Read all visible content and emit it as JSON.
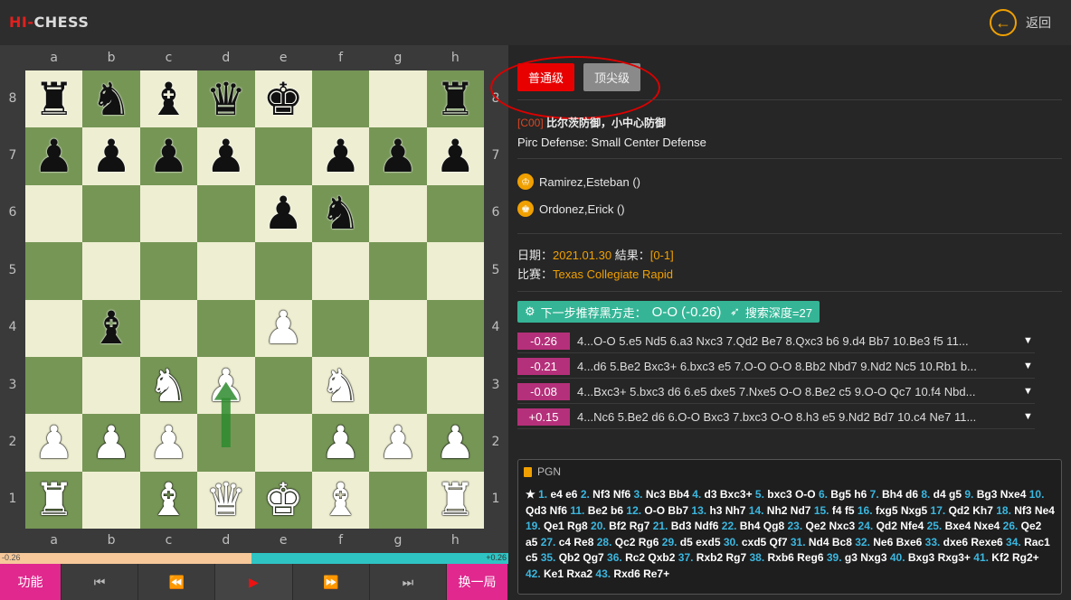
{
  "app": {
    "logo_red": "HI-",
    "logo_rest": "CHESS",
    "back_icon": "arrow-left-icon",
    "back_label": "返回"
  },
  "board": {
    "files": [
      "a",
      "b",
      "c",
      "d",
      "e",
      "f",
      "g",
      "h"
    ],
    "ranks": [
      "8",
      "7",
      "6",
      "5",
      "4",
      "3",
      "2",
      "1"
    ],
    "rows": [
      [
        "br",
        "bn",
        "bb",
        "bq",
        "bk",
        "",
        "",
        "br"
      ],
      [
        "bp",
        "bp",
        "bp",
        "bp",
        "",
        "bp",
        "bp",
        "bp"
      ],
      [
        "",
        "",
        "",
        "",
        "bp",
        "bn",
        "",
        ""
      ],
      [
        "",
        "",
        "",
        "",
        "",
        "",
        "",
        ""
      ],
      [
        "",
        "bb",
        "",
        "",
        "wp",
        "",
        "",
        ""
      ],
      [
        "",
        "",
        "wn",
        "wp",
        "",
        "wn",
        "",
        ""
      ],
      [
        "wp",
        "wp",
        "wp",
        "",
        "",
        "wp",
        "wp",
        "wp"
      ],
      [
        "wr",
        "",
        "wb",
        "wq",
        "wk",
        "wb",
        "",
        "wr"
      ]
    ],
    "arrow_from": "d2",
    "arrow_to": "d3",
    "arrow_color": "#2e8b2e"
  },
  "evalbar": {
    "left_label": "-0.26",
    "right_label": "+0.26",
    "fill_fraction": 0.495
  },
  "controls": {
    "func_label": "功能",
    "first_icon": "skip-first-icon",
    "prev_icon": "rewind-icon",
    "play_icon": "play-icon",
    "next_icon": "fast-forward-icon",
    "last_icon": "skip-last-icon",
    "newgame_label": "换一局"
  },
  "levels": {
    "normal": "普通级",
    "top": "顶尖级"
  },
  "opening": {
    "eco": "[C00]",
    "name_cn": "比尔茨防御，小中心防御",
    "name_en": "Pirc Defense: Small Center Defense"
  },
  "players": {
    "white": "Ramirez,Esteban ()",
    "black": "Ordonez,Erick ()"
  },
  "meta": {
    "date_label": "日期：",
    "date_value": "2021.01.30",
    "result_label": " 結果：",
    "result_value": "[0-1]",
    "event_label": "比赛：",
    "event_value": "Texas Collegiate Rapid"
  },
  "recommend": {
    "text": "下一步推荐黑方走：",
    "move": "O-O (-0.26)",
    "depth": "搜索深度=27"
  },
  "lines": [
    {
      "score": "-0.26",
      "text": "4...O-O 5.e5 Nd5 6.a3 Nxc3 7.Qd2 Be7 8.Qxc3 b6 9.d4 Bb7 10.Be3 f5 11..."
    },
    {
      "score": "-0.21",
      "text": "4...d6 5.Be2 Bxc3+ 6.bxc3 e5 7.O-O O-O 8.Bb2 Nbd7 9.Nd2 Nc5 10.Rb1 b..."
    },
    {
      "score": "-0.08",
      "text": "4...Bxc3+ 5.bxc3 d6 6.e5 dxe5 7.Nxe5 O-O 8.Be2 c5 9.O-O Qc7 10.f4 Nbd..."
    },
    {
      "score": "+0.15",
      "text": "4...Nc6 5.Be2 d6 6.O-O Bxc3 7.bxc3 O-O 8.h3 e5 9.Nd2 Bd7 10.c4 Ne7 11..."
    }
  ],
  "pgn": {
    "title": "PGN",
    "star": "★",
    "moves": [
      [
        "1.",
        "e4 e6"
      ],
      [
        "2.",
        "Nf3 Nf6"
      ],
      [
        "3.",
        "Nc3 Bb4"
      ],
      [
        "4.",
        "d3 Bxc3+"
      ],
      [
        "5.",
        "bxc3 O-O"
      ],
      [
        "6.",
        "Bg5 h6"
      ],
      [
        "7.",
        "Bh4 d6"
      ],
      [
        "8.",
        "d4 g5"
      ],
      [
        "9.",
        "Bg3 Nxe4"
      ],
      [
        "10.",
        "Qd3 Nf6"
      ],
      [
        "11.",
        "Be2 b6"
      ],
      [
        "12.",
        "O-O Bb7"
      ],
      [
        "13.",
        "h3 Nh7"
      ],
      [
        "14.",
        "Nh2 Nd7"
      ],
      [
        "15.",
        "f4 f5"
      ],
      [
        "16.",
        "fxg5 Nxg5"
      ],
      [
        "17.",
        "Qd2 Kh7"
      ],
      [
        "18.",
        "Nf3 Ne4"
      ],
      [
        "19.",
        "Qe1 Rg8"
      ],
      [
        "20.",
        "Bf2 Rg7"
      ],
      [
        "21.",
        "Bd3 Ndf6"
      ],
      [
        "22.",
        "Bh4 Qg8"
      ],
      [
        "23.",
        "Qe2 Nxc3"
      ],
      [
        "24.",
        "Qd2 Nfe4"
      ],
      [
        "25.",
        "Bxe4 Nxe4"
      ],
      [
        "26.",
        "Qe2 a5"
      ],
      [
        "27.",
        "c4 Re8"
      ],
      [
        "28.",
        "Qc2 Rg6"
      ],
      [
        "29.",
        "d5 exd5"
      ],
      [
        "30.",
        "cxd5 Qf7"
      ],
      [
        "31.",
        "Nd4 Bc8"
      ],
      [
        "32.",
        "Ne6 Bxe6"
      ],
      [
        "33.",
        "dxe6 Rexe6"
      ],
      [
        "34.",
        "Rac1 c5"
      ],
      [
        "35.",
        "Qb2 Qg7"
      ],
      [
        "36.",
        "Rc2 Qxb2"
      ],
      [
        "37.",
        "Rxb2 Rg7"
      ],
      [
        "38.",
        "Rxb6 Reg6"
      ],
      [
        "39.",
        "g3 Nxg3"
      ],
      [
        "40.",
        "Bxg3 Rxg3+"
      ],
      [
        "41.",
        "Kf2 Rg2+"
      ],
      [
        "42.",
        "Ke1 Rxa2"
      ],
      [
        "43.",
        "Rxd6 Re7+"
      ]
    ]
  }
}
